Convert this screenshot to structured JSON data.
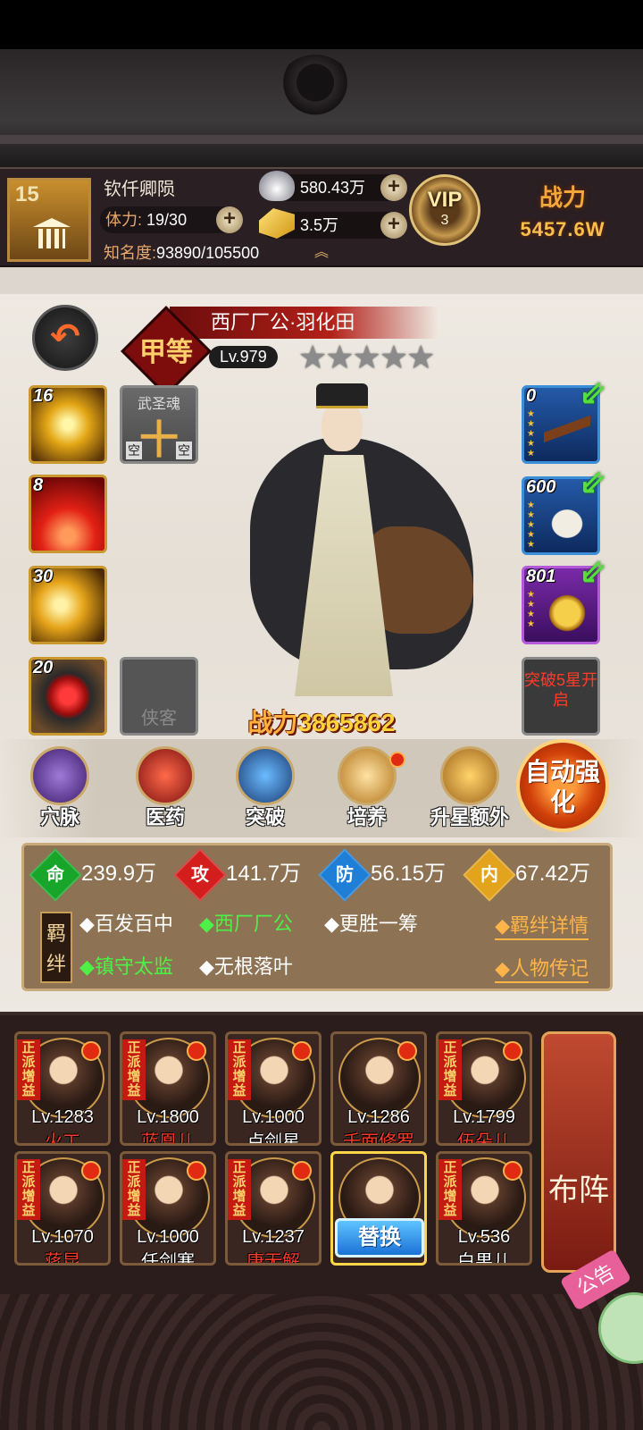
{
  "player": {
    "level": "15",
    "name": "钦仟卿陨",
    "stamina_label": "体力:",
    "stamina_value": "19/30",
    "fame_label": "知名度:",
    "fame_value": "93890/105500",
    "silver": "580.43万",
    "gold": "3.5万",
    "vip_label": "VIP",
    "vip_level": "3",
    "power_label": "战力",
    "power_value": "5457.6W"
  },
  "hero": {
    "grade": "甲等",
    "title": "西厂厂公·羽化田",
    "level": "Lv.979",
    "stars": "★★★★★",
    "power_label": "战力",
    "power_value": "3865862"
  },
  "skills": [
    {
      "num": "16",
      "icon": "golden-swirl-skill-icon"
    },
    {
      "num": "8",
      "icon": "red-explosion-skill-icon"
    },
    {
      "num": "30",
      "icon": "golden-wind-skill-icon"
    },
    {
      "num": "20",
      "icon": "red-orb-skill-icon"
    }
  ],
  "soul": {
    "title": "武圣魂",
    "big": "十",
    "left": "空",
    "right": "空"
  },
  "knight_label": "侠客",
  "equipment": [
    {
      "num": "0",
      "icon": "musket-icon"
    },
    {
      "num": "600",
      "icon": "robe-icon"
    },
    {
      "num": "801",
      "icon": "charm-icon"
    }
  ],
  "breakthrough_text": "突破5星开启",
  "menu": [
    {
      "label": "穴脉",
      "icon": "meridian-icon"
    },
    {
      "label": "医药",
      "icon": "medicine-icon"
    },
    {
      "label": "突破",
      "icon": "breakthrough-icon"
    },
    {
      "label": "培养",
      "icon": "train-icon"
    },
    {
      "label": "升星额外",
      "icon": "star-up-icon"
    }
  ],
  "auto_strengthen": "自动强化",
  "attributes": [
    {
      "badge": "命",
      "value": "239.9万",
      "color": "#17a52a"
    },
    {
      "badge": "攻",
      "value": "141.7万",
      "color": "#d41d1d"
    },
    {
      "badge": "防",
      "value": "56.15万",
      "color": "#1f7fd6"
    },
    {
      "badge": "内",
      "value": "67.42万",
      "color": "#e3a41d"
    }
  ],
  "bond_tag": "羁绊",
  "bonds": [
    {
      "text": "◆百发百中",
      "active": false
    },
    {
      "text": "◆西厂厂公",
      "active": true
    },
    {
      "text": "◆更胜一筹",
      "active": false
    },
    {
      "text": "◆镇守太监",
      "active": true
    },
    {
      "text": "◆无根落叶",
      "active": false
    }
  ],
  "bond_detail_link": "◆羁绊详情",
  "biography_link": "◆人物传记",
  "roster_tag": "正派增益",
  "roster": [
    {
      "level": "Lv.1283",
      "name": "火工",
      "name_color": "red"
    },
    {
      "level": "Lv.1800",
      "name": "蓝凰儿",
      "name_color": "red"
    },
    {
      "level": "Lv.1000",
      "name": "卢剑星",
      "name_color": "white"
    },
    {
      "level": "Lv.1286",
      "name": "千面修罗",
      "name_color": "red"
    },
    {
      "level": "Lv.1799",
      "name": "伍朵儿",
      "name_color": "red"
    },
    {
      "level": "Lv.1070",
      "name": "蒋昆",
      "name_color": "red"
    },
    {
      "level": "Lv.1000",
      "name": "任剑寒",
      "name_color": "white"
    },
    {
      "level": "Lv.1237",
      "name": "唐无解",
      "name_color": "red"
    },
    {
      "level": "",
      "name": "",
      "name_color": "white"
    },
    {
      "level": "Lv.536",
      "name": "白果儿",
      "name_color": "white"
    }
  ],
  "swap_label": "替换",
  "formation_label": "布阵",
  "notice_label": "公告"
}
